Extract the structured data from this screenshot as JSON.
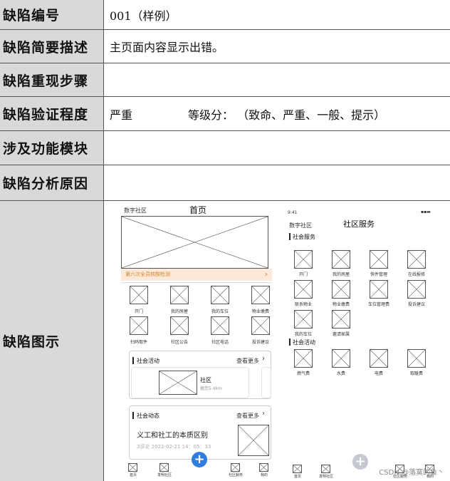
{
  "form": {
    "rows": [
      {
        "label": "缺陷编号",
        "value": "001（样例）"
      },
      {
        "label": "缺陷简要描述",
        "value": "主页面内容显示出错。"
      },
      {
        "label": "缺陷重现步骤",
        "value": ""
      },
      {
        "label": "缺陷验证程度",
        "value": "严重",
        "value2": "等级分：  （致命、严重、一般、提示）"
      },
      {
        "label": "涉及功能模块",
        "value": ""
      },
      {
        "label": "缺陷分析原因",
        "value": ""
      },
      {
        "label": "缺陷图示",
        "value": ""
      }
    ]
  },
  "home": {
    "app_name": "数字社区",
    "title": "首页",
    "banner": "第六次全员核酸检测",
    "banner_arrow": "›",
    "grid": [
      "开门",
      "我的房屋",
      "我的车位",
      "物业缴费",
      "扫码取件",
      "社区公告",
      "社区电话",
      "投诉建议"
    ],
    "activity": {
      "title": "社会活动",
      "more": "查看更多",
      "item_name": "社区",
      "item_sub": "据您5.4km"
    },
    "news": {
      "title": "社会动态",
      "more": "查看更多",
      "headline": "义工和社工的本质区别",
      "meta": "3评论 2022-02-21 14：05：33"
    },
    "tabs": [
      "首页",
      "发明社区",
      "社区服务",
      "我的"
    ]
  },
  "service": {
    "status_time": "9:41",
    "app_name": "数字社区",
    "title": "社区服务",
    "section1": "社会服务",
    "grid1": [
      "开门",
      "我的房屋",
      "快件管理",
      "在线报修",
      "联系物业",
      "物业缴费",
      "车位管理费",
      "投诉建议",
      "我的车位",
      "邀请家属"
    ],
    "section2": "社会活动",
    "grid2": [
      "燃气费",
      "水费",
      "电费",
      "取暖费"
    ],
    "tabs": [
      "首页",
      "发明社区",
      "社区服务",
      "我的"
    ]
  },
  "watermark": "CSDN @落寞的鱼丶"
}
